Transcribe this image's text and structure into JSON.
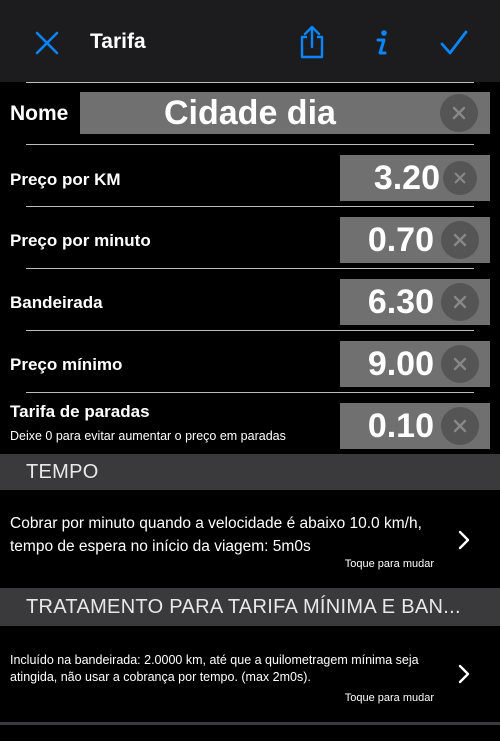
{
  "nav": {
    "title": "Tarifa",
    "icons": [
      "close-icon",
      "share-icon",
      "info-icon",
      "checkmark-icon"
    ],
    "accent_color": "#0a84ff"
  },
  "name": {
    "label": "Nome",
    "value": "Cidade dia"
  },
  "fields": [
    {
      "label": "Preço por KM",
      "value": "3.20"
    },
    {
      "label": "Preço por minuto",
      "value": "0.70"
    },
    {
      "label": "Bandeirada",
      "value": "6.30"
    },
    {
      "label": "Preço mínimo",
      "value": "9.00"
    },
    {
      "label": "Tarifa de paradas",
      "value": "0.10",
      "sublabel": "Deixe 0 para evitar aumentar o preço em paradas"
    }
  ],
  "sections": [
    {
      "header": "TEMPO",
      "text": "Cobrar por minuto quando a velocidade é abaixo 10.0 km/h, tempo de espera no início da viagem: 5m0s",
      "hint": "Toque para mudar"
    },
    {
      "header": "TRATAMENTO PARA TARIFA MÍNIMA E BAN...",
      "text": "Incluído na bandeirada: 2.0000 km, até que a quilometragem mínima seja atingida, não usar a cobrança por tempo. (max 2m0s).",
      "hint": "Toque para mudar"
    }
  ]
}
